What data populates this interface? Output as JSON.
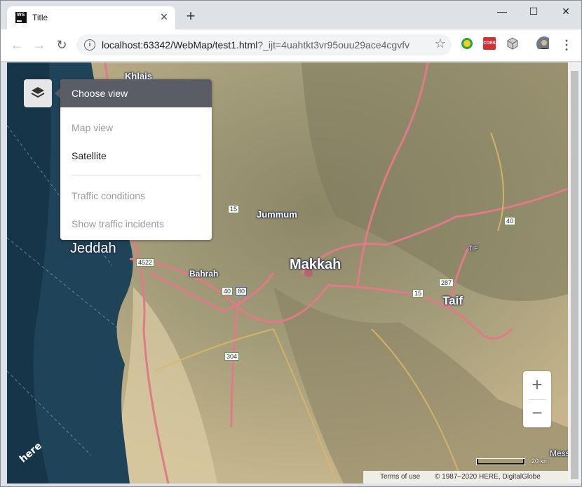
{
  "browser": {
    "tab_title": "Title",
    "tab_icon_text": "WS",
    "url_host": "localhost:63342/WebMap/test1.html",
    "url_query": "?_ijt=4uahtkt3vr95ouu29ace4cgvfv",
    "extension_cors_label": "CORS"
  },
  "window_controls": {
    "minimize": "—",
    "maximize": "☐",
    "close": "✕"
  },
  "layers_panel": {
    "title": "Choose view",
    "base_items": [
      "Map view",
      "Satellite"
    ],
    "selected_base": "Satellite",
    "overlay_items": [
      "Traffic conditions",
      "Show traffic incidents"
    ]
  },
  "map": {
    "cities": {
      "jeddah": "Jeddah",
      "makkah": "Makkah",
      "taif": "Taif",
      "jummum": "Jummum",
      "bahrah": "Bahrah",
      "khlais": "Khlais",
      "mess": "Mess"
    },
    "shields": {
      "r4522": "4522",
      "r15a": "15",
      "r15b": "15",
      "r40a": "40",
      "r40b": "40",
      "r80": "80",
      "r304": "304",
      "r287": "287",
      "tif": "TIF"
    },
    "zoom": {
      "in_label": "+",
      "out_label": "−"
    },
    "scale_label": "20 km",
    "footer": {
      "terms": "Terms of use",
      "copyright": "© 1987–2020 HERE, DigitalGlobe"
    },
    "logo_text": "here",
    "colors": {
      "road": "#e07a88",
      "minor_road": "#d9b866",
      "sea": "#1f4358",
      "land": "#c9b891"
    }
  }
}
